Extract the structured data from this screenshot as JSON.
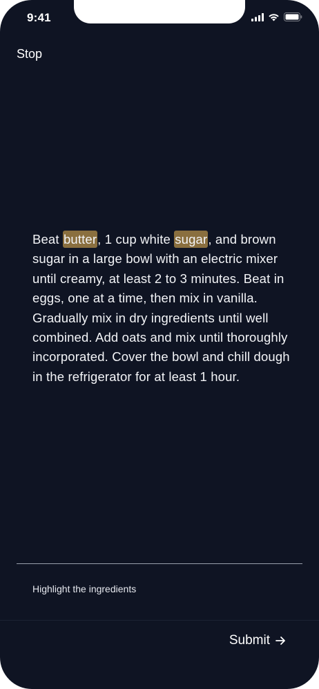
{
  "status_bar": {
    "time": "9:41"
  },
  "header": {
    "stop_label": "Stop"
  },
  "passage": {
    "seg_1": "Beat ",
    "highlight_1": "butter",
    "seg_2": ", 1 cup white ",
    "highlight_2": "sugar",
    "seg_3": ", and brown sugar in a large bowl with an electric mixer until creamy, at least 2 to 3 minutes. Beat in eggs, one at a time, then mix in vanilla. Gradually mix in dry ingredients until well combined. Add oats and mix until thoroughly incorporated. Cover the bowl and chill dough in the refrigerator for at least 1 hour."
  },
  "instruction": "Highlight the ingredients",
  "footer": {
    "submit_label": "Submit",
    "submit_icon": "arrow-right-icon"
  },
  "colors": {
    "background": "#0f1423",
    "highlight": "#8a6f3f",
    "text": "#ffffff"
  }
}
